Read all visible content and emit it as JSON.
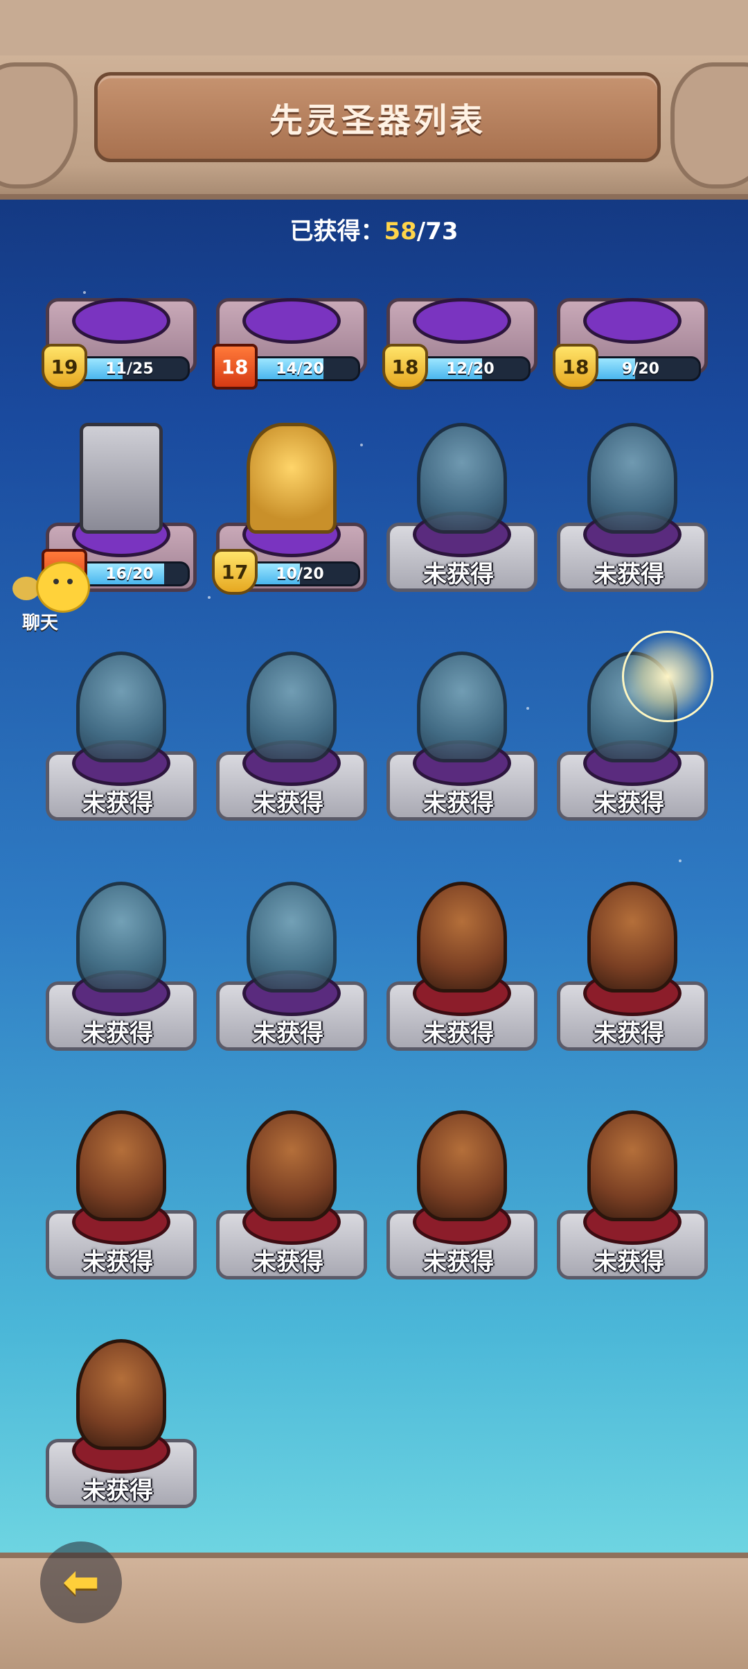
{
  "header": {
    "title": "先灵圣器列表"
  },
  "summary": {
    "label": "已获得：",
    "obtained": "58",
    "separator": "/",
    "total": "73"
  },
  "chat": {
    "label": "聊天"
  },
  "back_icon": "arrow-left-icon",
  "relics": [
    {
      "status": "owned",
      "level": "19",
      "progress_text": "11/25",
      "progress": 0.44,
      "badge": "gold"
    },
    {
      "status": "owned",
      "level": "18",
      "progress_text": "14/20",
      "progress": 0.7,
      "badge": "red"
    },
    {
      "status": "owned",
      "level": "18",
      "progress_text": "12/20",
      "progress": 0.6,
      "badge": "gold"
    },
    {
      "status": "owned",
      "level": "18",
      "progress_text": "9/20",
      "progress": 0.45,
      "badge": "gold"
    },
    {
      "status": "owned",
      "level": "",
      "progress_text": "16/20",
      "progress": 0.8,
      "badge": "red"
    },
    {
      "status": "owned",
      "level": "17",
      "progress_text": "10/20",
      "progress": 0.5,
      "badge": "gold"
    },
    {
      "status": "locked",
      "label": "未获得"
    },
    {
      "status": "locked",
      "label": "未获得"
    },
    {
      "status": "locked",
      "label": "未获得"
    },
    {
      "status": "locked",
      "label": "未获得"
    },
    {
      "status": "locked",
      "label": "未获得"
    },
    {
      "status": "locked",
      "label": "未获得"
    },
    {
      "status": "locked",
      "label": "未获得"
    },
    {
      "status": "locked",
      "label": "未获得"
    },
    {
      "status": "locked",
      "label": "未获得"
    },
    {
      "status": "locked",
      "label": "未获得"
    },
    {
      "status": "locked",
      "label": "未获得"
    },
    {
      "status": "locked",
      "label": "未获得"
    },
    {
      "status": "locked",
      "label": "未获得"
    },
    {
      "status": "locked",
      "label": "未获得"
    },
    {
      "status": "locked",
      "label": "未获得"
    }
  ]
}
